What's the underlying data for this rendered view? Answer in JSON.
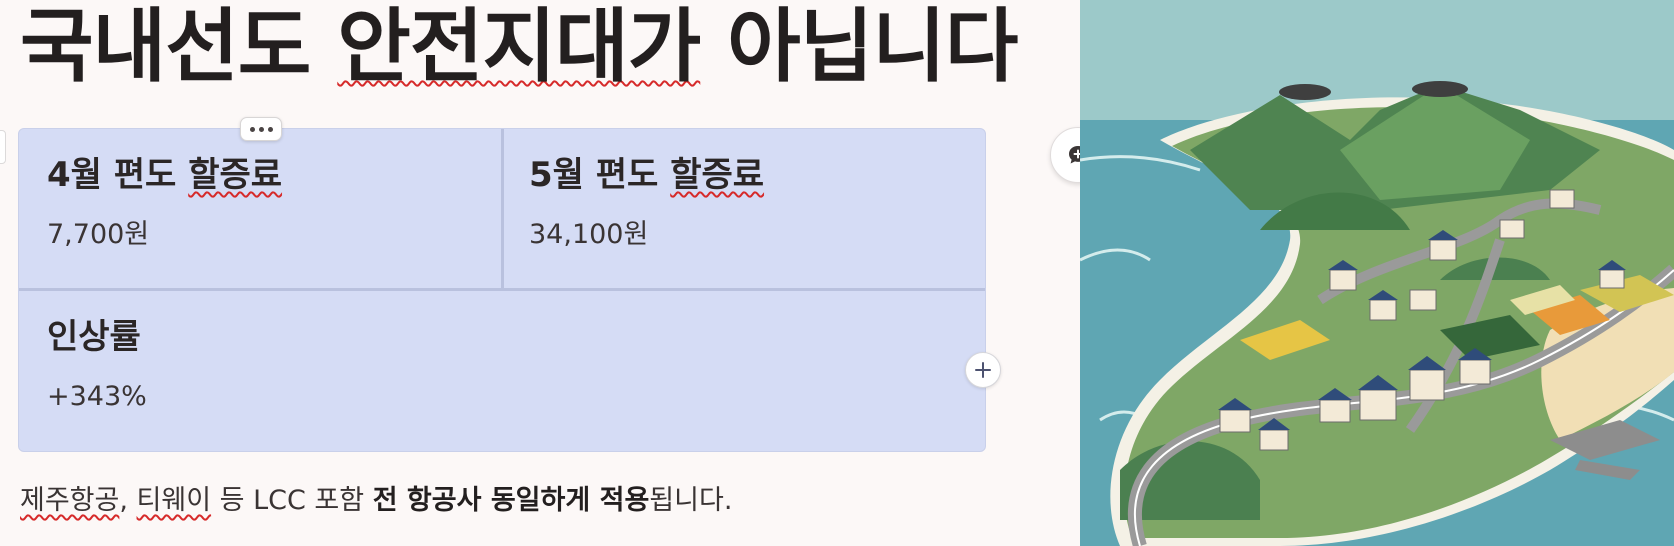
{
  "title": {
    "part1": "국내선도",
    "part2": "안전지대가",
    "part3": "아닙니다"
  },
  "table": {
    "cells": [
      {
        "label_main": "4월 편도",
        "label_flagged": "할증료",
        "value": "7,700원"
      },
      {
        "label_main": "5월 편도",
        "label_flagged": "할증료",
        "value": "34,100원"
      },
      {
        "label": "인상률",
        "value": "+343%"
      }
    ]
  },
  "footer": {
    "seg1": "제주항공",
    "seg2": ", ",
    "seg3": "티웨이",
    "seg4": " 등 LCC 포함 ",
    "bold": "전 항공사 동일하게 적용",
    "seg5": "됩니다."
  },
  "icons": {
    "more": "more-horizontal-icon",
    "add": "plus-icon",
    "comment": "add-comment-icon"
  },
  "colors": {
    "background": "#fcf8f7",
    "table_fill": "#d5dcf5",
    "table_divider": "#b9c1de",
    "spellcheck": "#d62a2a"
  }
}
